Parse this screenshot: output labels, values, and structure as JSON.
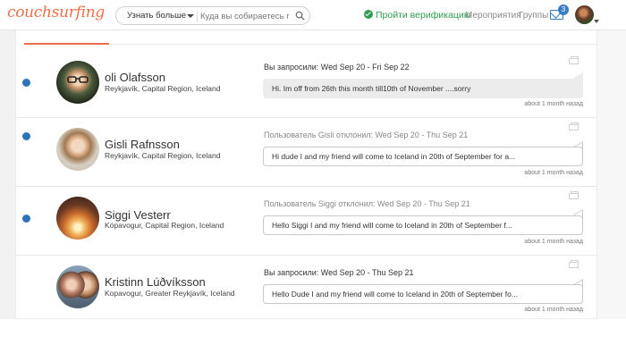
{
  "header": {
    "logo": "couchsurfing",
    "search_mode": "Узнать больше",
    "search_placeholder": "Куда вы собираетесь г",
    "verify_label": "Пройти верификацию",
    "nav": [
      "Мероприятия",
      "Группы"
    ],
    "mail_badge": "3",
    "accent": "#ee6e4a",
    "verify_color": "#2e9e4f",
    "link_color": "#3a7ec2"
  },
  "conversations": [
    {
      "name": "oli Olafsson",
      "location": "Reykjavík, Capital Region, Iceland",
      "status": "Вы запросили: Wed Sep 20 - Fri Sep 22",
      "message": "Hi. Im off from 26th this month till10th of November ....sorry",
      "time": "about 1 month назад",
      "unread": true
    },
    {
      "name": "Gisli Rafnsson",
      "location": "Reykjavík, Capital Region, Iceland",
      "status": "Пользователь Gisli отклонил: Wed Sep 20 - Thu Sep 21",
      "message": "Hi dude I and my friend will come to Iceland in 20th of September for a...",
      "time": "about 1 month назад",
      "unread": true
    },
    {
      "name": "Siggi Vesterr",
      "location": "Kópavogur, Capital Region, Iceland",
      "status": "Пользователь Siggi отклонил: Wed Sep 20 - Thu Sep 21",
      "message": "Hello Siggi I and my friend will come to Iceland in 20th of September f...",
      "time": "about 1 month назад",
      "unread": true
    },
    {
      "name": "Kristinn Lúðvíksson",
      "location": "Kopavogur, Greater Reykjavík, Iceland",
      "status": "Вы запросили: Wed Sep 20 - Thu Sep 21",
      "message": "Hello Dude I and my friend will come to Iceland in 20th of September fo...",
      "time": "about 1 month назад",
      "unread": false
    }
  ]
}
